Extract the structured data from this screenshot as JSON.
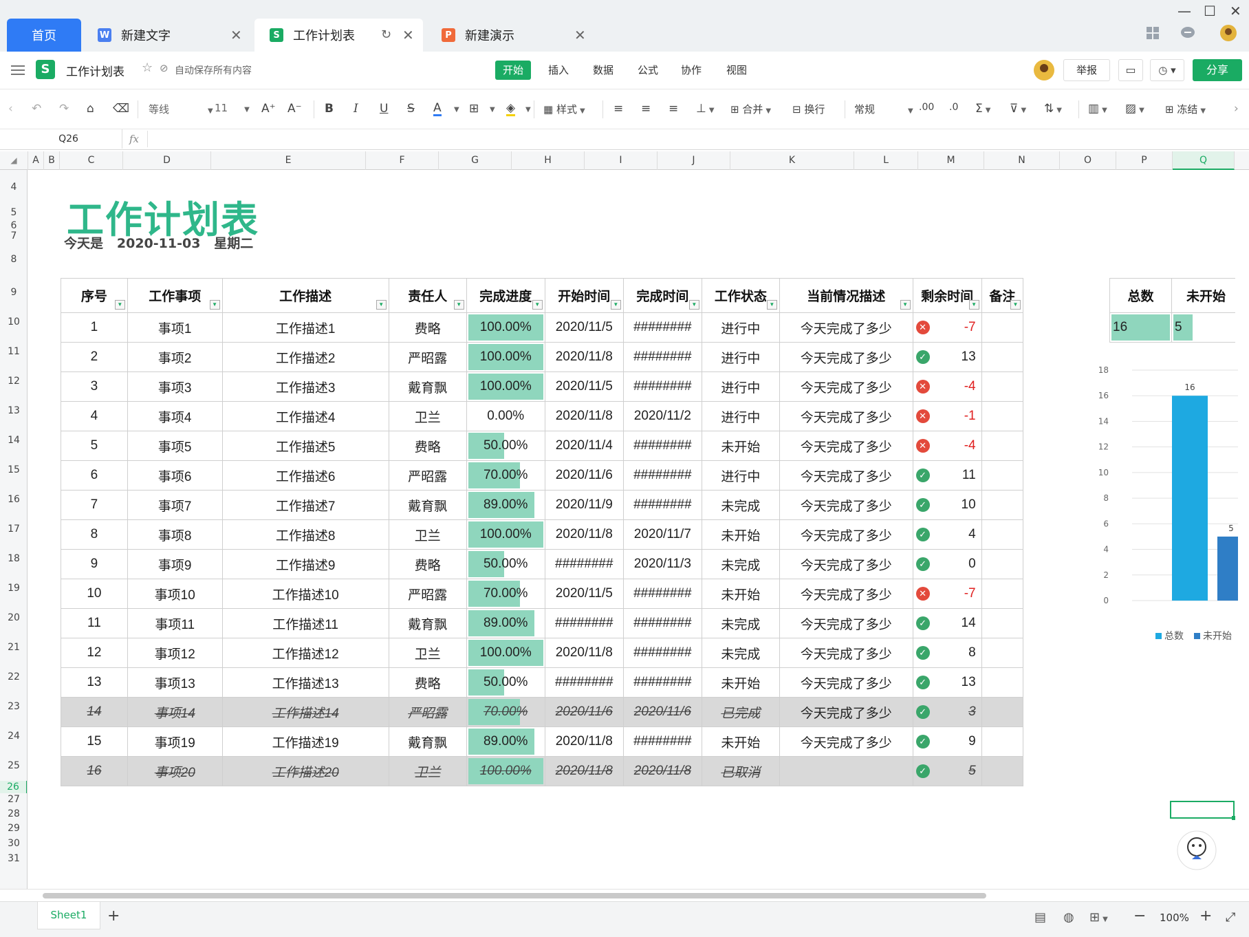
{
  "tabs": {
    "home": "首页",
    "doc1": "新建文字",
    "doc2": "工作计划表",
    "doc3": "新建演示"
  },
  "menubar": {
    "filename": "工作计划表",
    "autosave": "自动保存所有内容",
    "menus": [
      "开始",
      "插入",
      "数据",
      "公式",
      "协作",
      "视图"
    ],
    "report": "举报",
    "share": "分享"
  },
  "toolbar": {
    "font": "等线",
    "size": "11",
    "style": "样式",
    "merge": "合并",
    "wrap": "换行",
    "format": "常规",
    "freeze": "冻结"
  },
  "formula": {
    "cellref": "Q26",
    "fx": "fx"
  },
  "columns": [
    "A",
    "B",
    "C",
    "D",
    "E",
    "F",
    "G",
    "H",
    "I",
    "J",
    "K",
    "L",
    "M",
    "N",
    "O",
    "P",
    "Q"
  ],
  "rows": [
    "4",
    "5",
    "6",
    "7",
    "8",
    "9",
    "10",
    "11",
    "12",
    "13",
    "14",
    "15",
    "16",
    "17",
    "18",
    "19",
    "20",
    "21",
    "22",
    "23",
    "24",
    "25",
    "26",
    "27",
    "28",
    "29",
    "30",
    "31"
  ],
  "sheet": {
    "title": "工作计划表",
    "today_label": "今天是",
    "today_date": "2020-11-03",
    "today_weekday": "星期二"
  },
  "table": {
    "headers": [
      "序号",
      "工作事项",
      "工作描述",
      "责任人",
      "完成进度",
      "开始时间",
      "完成时间",
      "工作状态",
      "当前情况描述",
      "剩余时间",
      "备注"
    ],
    "rows": [
      {
        "no": "1",
        "item": "事项1",
        "desc": "工作描述1",
        "owner": "费略",
        "progress": "100.00%",
        "pct": 100,
        "start": "2020/11/5",
        "end": "########",
        "state": "进行中",
        "note": "今天完成了多少",
        "ok": false,
        "remain": "-7",
        "strike": false
      },
      {
        "no": "2",
        "item": "事项2",
        "desc": "工作描述2",
        "owner": "严昭露",
        "progress": "100.00%",
        "pct": 100,
        "start": "2020/11/8",
        "end": "########",
        "state": "进行中",
        "note": "今天完成了多少",
        "ok": true,
        "remain": "13",
        "strike": false
      },
      {
        "no": "3",
        "item": "事项3",
        "desc": "工作描述3",
        "owner": "戴育飘",
        "progress": "100.00%",
        "pct": 100,
        "start": "2020/11/5",
        "end": "########",
        "state": "进行中",
        "note": "今天完成了多少",
        "ok": false,
        "remain": "-4",
        "strike": false
      },
      {
        "no": "4",
        "item": "事项4",
        "desc": "工作描述4",
        "owner": "卫兰",
        "progress": "0.00%",
        "pct": 0,
        "start": "2020/11/8",
        "end": "2020/11/2",
        "state": "进行中",
        "note": "今天完成了多少",
        "ok": false,
        "remain": "-1",
        "strike": false
      },
      {
        "no": "5",
        "item": "事项5",
        "desc": "工作描述5",
        "owner": "费略",
        "progress": "50.00%",
        "pct": 50,
        "start": "2020/11/4",
        "end": "########",
        "state": "未开始",
        "note": "今天完成了多少",
        "ok": false,
        "remain": "-4",
        "strike": false
      },
      {
        "no": "6",
        "item": "事项6",
        "desc": "工作描述6",
        "owner": "严昭露",
        "progress": "70.00%",
        "pct": 70,
        "start": "2020/11/6",
        "end": "########",
        "state": "进行中",
        "note": "今天完成了多少",
        "ok": true,
        "remain": "11",
        "strike": false
      },
      {
        "no": "7",
        "item": "事项7",
        "desc": "工作描述7",
        "owner": "戴育飘",
        "progress": "89.00%",
        "pct": 89,
        "start": "2020/11/9",
        "end": "########",
        "state": "未完成",
        "note": "今天完成了多少",
        "ok": true,
        "remain": "10",
        "strike": false
      },
      {
        "no": "8",
        "item": "事项8",
        "desc": "工作描述8",
        "owner": "卫兰",
        "progress": "100.00%",
        "pct": 100,
        "start": "2020/11/8",
        "end": "2020/11/7",
        "state": "未开始",
        "note": "今天完成了多少",
        "ok": true,
        "remain": "4",
        "strike": false
      },
      {
        "no": "9",
        "item": "事项9",
        "desc": "工作描述9",
        "owner": "费略",
        "progress": "50.00%",
        "pct": 50,
        "start": "########",
        "end": "2020/11/3",
        "state": "未完成",
        "note": "今天完成了多少",
        "ok": true,
        "remain": "0",
        "strike": false
      },
      {
        "no": "10",
        "item": "事项10",
        "desc": "工作描述10",
        "owner": "严昭露",
        "progress": "70.00%",
        "pct": 70,
        "start": "2020/11/5",
        "end": "########",
        "state": "未开始",
        "note": "今天完成了多少",
        "ok": false,
        "remain": "-7",
        "strike": false
      },
      {
        "no": "11",
        "item": "事项11",
        "desc": "工作描述11",
        "owner": "戴育飘",
        "progress": "89.00%",
        "pct": 89,
        "start": "########",
        "end": "########",
        "state": "未完成",
        "note": "今天完成了多少",
        "ok": true,
        "remain": "14",
        "strike": false
      },
      {
        "no": "12",
        "item": "事项12",
        "desc": "工作描述12",
        "owner": "卫兰",
        "progress": "100.00%",
        "pct": 100,
        "start": "2020/11/8",
        "end": "########",
        "state": "未完成",
        "note": "今天完成了多少",
        "ok": true,
        "remain": "8",
        "strike": false
      },
      {
        "no": "13",
        "item": "事项13",
        "desc": "工作描述13",
        "owner": "费略",
        "progress": "50.00%",
        "pct": 50,
        "start": "########",
        "end": "########",
        "state": "未开始",
        "note": "今天完成了多少",
        "ok": true,
        "remain": "13",
        "strike": false
      },
      {
        "no": "14",
        "item": "事项14",
        "desc": "工作描述14",
        "owner": "严昭露",
        "progress": "70.00%",
        "pct": 70,
        "start": "2020/11/6",
        "end": "2020/11/6",
        "state": "已完成",
        "note": "今天完成了多少",
        "ok": true,
        "remain": "3",
        "strike": true
      },
      {
        "no": "15",
        "item": "事项19",
        "desc": "工作描述19",
        "owner": "戴育飘",
        "progress": "89.00%",
        "pct": 89,
        "start": "2020/11/8",
        "end": "########",
        "state": "未开始",
        "note": "今天完成了多少",
        "ok": true,
        "remain": "9",
        "strike": false
      },
      {
        "no": "16",
        "item": "事项20",
        "desc": "工作描述20",
        "owner": "卫兰",
        "progress": "100.00%",
        "pct": 100,
        "start": "2020/11/8",
        "end": "2020/11/8",
        "state": "已取消",
        "note": "",
        "ok": true,
        "remain": "5",
        "strike": true
      }
    ]
  },
  "summary": {
    "headers": [
      "总数",
      "未开始"
    ],
    "values": [
      "16",
      "5"
    ]
  },
  "chart_data": {
    "type": "bar",
    "categories": [
      ""
    ],
    "series": [
      {
        "name": "总数",
        "values": [
          16
        ],
        "color": "#1ea9e1"
      },
      {
        "name": "未开始",
        "values": [
          5
        ],
        "color": "#2f7ec6"
      }
    ],
    "ylim": [
      0,
      18
    ],
    "yticks": [
      "0",
      "2",
      "4",
      "6",
      "8",
      "10",
      "12",
      "14",
      "16",
      "18"
    ],
    "data_labels": [
      "16",
      "5"
    ],
    "legend": "bottom"
  },
  "status": {
    "sheet_tab": "Sheet1",
    "zoom": "100%"
  }
}
